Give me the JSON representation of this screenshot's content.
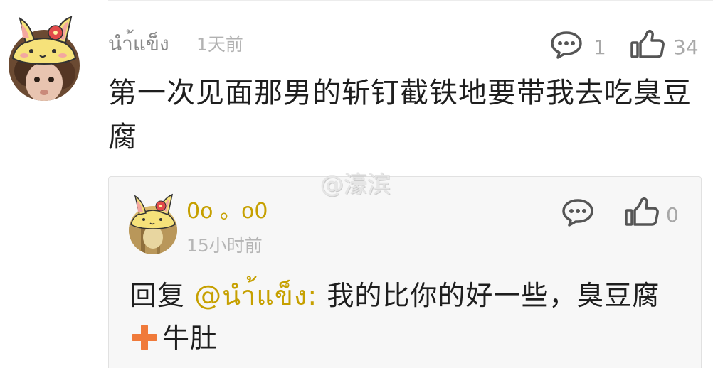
{
  "main_comment": {
    "username": "นำ้แข็ง",
    "timestamp": "1天前",
    "text": "第一次见面那男的斩钉截铁地要带我去吃臭豆腐",
    "reply_count": "1",
    "like_count": "34"
  },
  "watermark": "@濠滨",
  "reply": {
    "username": "0o 。o0",
    "timestamp": "15小时前",
    "like_count": "0",
    "prefix": "回复 ",
    "mention": "@นำ้แข็ง:",
    "text_before": " 我的比你的好一些，臭豆腐",
    "text_after": "牛肚"
  },
  "colors": {
    "mention": "#c6a000",
    "plus": "#f07a3a",
    "icon": "#555555"
  }
}
